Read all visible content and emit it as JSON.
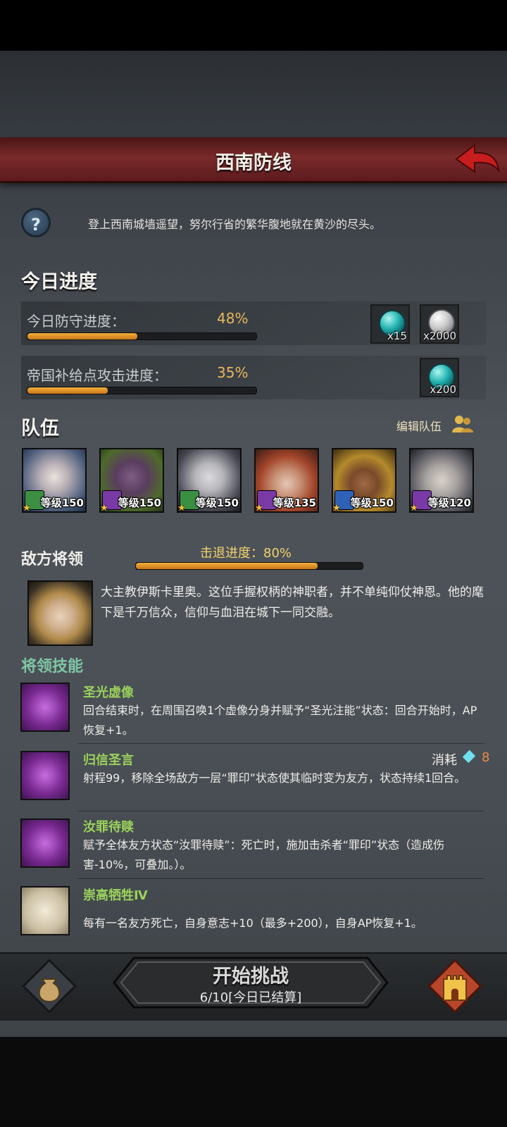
{
  "header": {
    "title": "西南防线"
  },
  "intro": {
    "text": "登上西南城墙遥望，努尔行省的繁华腹地就在黄沙的尽头。"
  },
  "today": {
    "heading": "今日进度",
    "rows": [
      {
        "label": "今日防守进度：",
        "percent": "48%",
        "progress": 0.48,
        "rewards": [
          {
            "icon": "teal-gem-icon",
            "qty": "x15"
          },
          {
            "icon": "silver-coin-icon",
            "qty": "x2000"
          }
        ]
      },
      {
        "label": "帝国补给点攻击进度：",
        "percent": "35%",
        "progress": 0.35,
        "rewards": [
          {
            "icon": "teal-gem-icon",
            "qty": "x200"
          }
        ]
      }
    ]
  },
  "team": {
    "heading": "队伍",
    "edit_label": "编辑队伍",
    "heroes": [
      {
        "level": "等级150",
        "class": "bow"
      },
      {
        "level": "等级150",
        "class": "staff"
      },
      {
        "level": "等级150",
        "class": "bow"
      },
      {
        "level": "等级135",
        "class": "staff"
      },
      {
        "level": "等级150",
        "class": "sword"
      },
      {
        "level": "等级120",
        "class": "staff"
      }
    ]
  },
  "enemy": {
    "heading": "敌方将领",
    "repel_label": "击退进度：80%",
    "repel_progress": 0.8,
    "description": "大主教伊斯卡里奥。这位手握权柄的神职者，并不单纯仰仗神恩。他的麾下是千万信众，信仰与血泪在城下一同交融。"
  },
  "skills": {
    "heading": "将领技能",
    "cost_label": "消耗",
    "cost_value": "8",
    "items": [
      {
        "name": "圣光虚像",
        "desc": "回合结束时，在周围召唤1个虚像分身并赋予“圣光注能”状态：回合开始时，AP恢复+1。"
      },
      {
        "name": "归信圣言",
        "desc": "射程99，移除全场敌方一层“罪印”状态使其临时变为友方，状态持续1回合。"
      },
      {
        "name": "汝罪待赎",
        "desc": "赋予全体友方状态“汝罪待赎”：死亡时，施加击杀者“罪印”状态（造成伤害-10%，可叠加。）。"
      },
      {
        "name": "崇高牺牲Ⅳ",
        "desc": "每有一名友方死亡，自身意志+10（最多+200），自身AP恢复+1。"
      }
    ]
  },
  "footer": {
    "start_label": "开始挑战",
    "start_sub": "6/10[今日已结算]"
  },
  "colors": {
    "accent_orange": "#e9b75b",
    "skill_green": "#9ad15b",
    "header_red": "#7a2a2a"
  }
}
